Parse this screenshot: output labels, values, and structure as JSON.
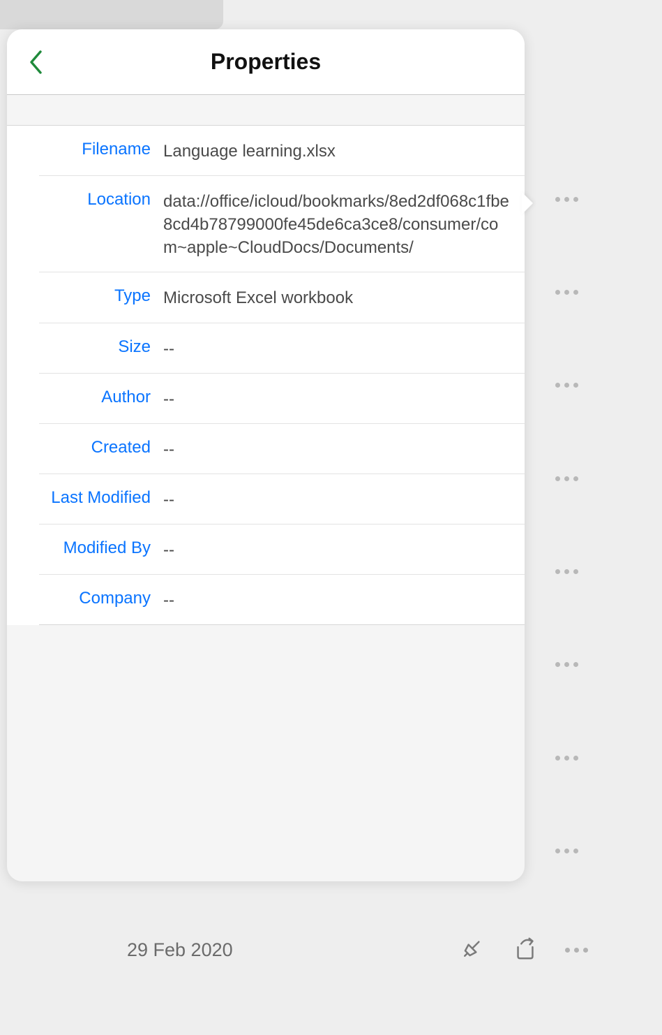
{
  "panel": {
    "title": "Properties",
    "rows": {
      "filename": {
        "label": "Filename",
        "value": "Language learning.xlsx"
      },
      "location": {
        "label": "Location",
        "value": "data://office/icloud/bookmarks/8ed2df068c1fbe8cd4b78799000fe45de6ca3ce8/consumer/com~apple~CloudDocs/Documents/"
      },
      "type": {
        "label": "Type",
        "value": "Microsoft Excel workbook"
      },
      "size": {
        "label": "Size",
        "value": "--"
      },
      "author": {
        "label": "Author",
        "value": "--"
      },
      "created": {
        "label": "Created",
        "value": "--"
      },
      "last_modified": {
        "label": "Last Modified",
        "value": "--"
      },
      "modified_by": {
        "label": "Modified By",
        "value": "--"
      },
      "company": {
        "label": "Company",
        "value": "--"
      }
    }
  },
  "footer": {
    "date": "29 Feb 2020"
  }
}
